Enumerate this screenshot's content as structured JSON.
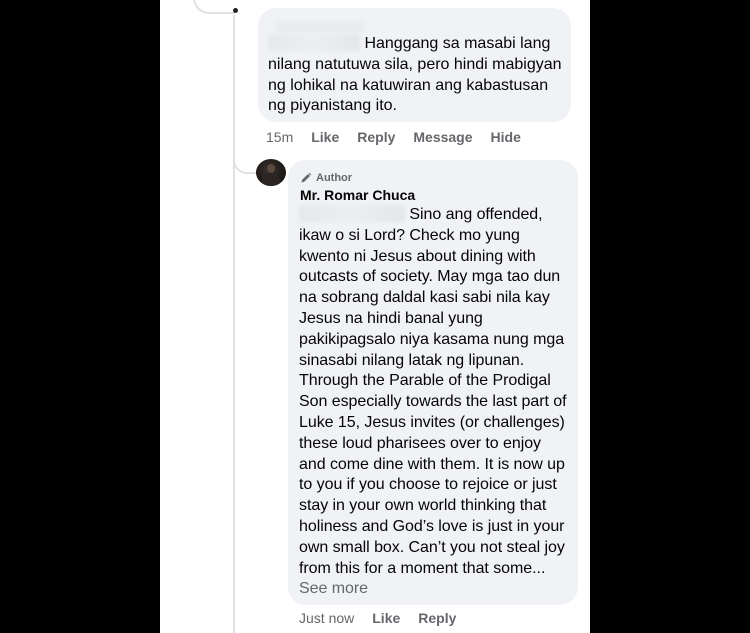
{
  "comment1": {
    "text_before_blur": "",
    "text": "Hanggang sa masabi lang nilang natutuwa sila, pero hindi mabigyan ng lohikal na katuwiran ang kabastusan ng piyanistang ito.",
    "time": "15m",
    "like": "Like",
    "reply": "Reply",
    "message": "Message",
    "hide": "Hide"
  },
  "comment2": {
    "author_badge": "Author",
    "name": "Mr. Romar Chuca",
    "text": "Sino ang offended, ikaw o si Lord? Check mo yung kwento ni Jesus about dining with outcasts of society. May mga tao dun na sobrang daldal kasi sabi nila kay Jesus na hindi banal yung pakikipagsalo niya kasama nung mga sinasabi nilang latak ng lipunan. Through the Parable of the Prodigal Son especially towards the last part of Luke 15, Jesus invites (or challenges) these loud pharisees over to enjoy and come dine with them. It is now up to you if you choose to rejoice or just stay in your own world thinking that holiness and God’s love is just in your own small box. Can’t you not steal joy from this for a moment that some...",
    "see_more": "See more",
    "time": "Just now",
    "like": "Like",
    "reply": "Reply"
  },
  "icons": {
    "author": "pencil-icon"
  }
}
